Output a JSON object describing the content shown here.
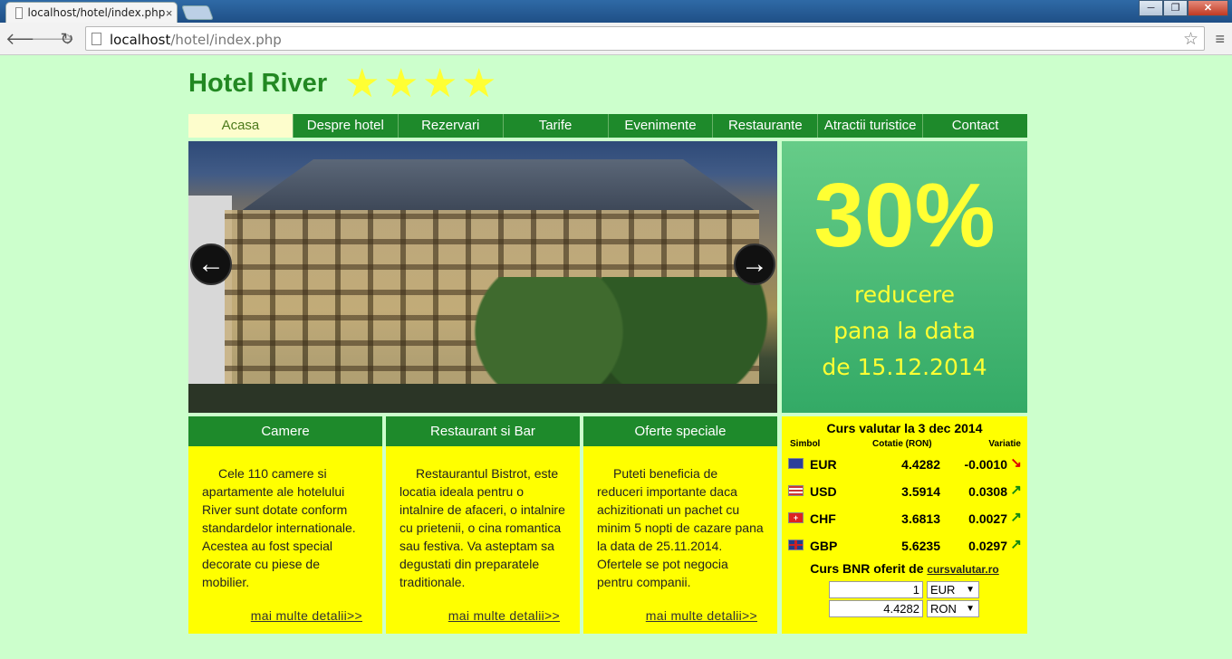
{
  "browser": {
    "tab_title": "localhost/hotel/index.php",
    "tab_close": "×",
    "url_host": "localhost",
    "url_path": "/hotel/index.php",
    "window_buttons": [
      "─",
      "❐",
      "✕"
    ]
  },
  "header": {
    "title": "Hotel River",
    "stars": [
      "★",
      "★",
      "★",
      "★"
    ]
  },
  "nav": [
    {
      "label": "Acasa",
      "active": true
    },
    {
      "label": "Despre hotel"
    },
    {
      "label": "Rezervari"
    },
    {
      "label": "Tarife"
    },
    {
      "label": "Evenimente"
    },
    {
      "label": "Restaurante"
    },
    {
      "label": "Atractii turistice"
    },
    {
      "label": "Contact"
    }
  ],
  "slider": {
    "prev_glyph": "←",
    "next_glyph": "→"
  },
  "promo": {
    "percent": "30%",
    "line1": "reducere",
    "line2": "pana la data",
    "line3": "de 15.12.2014"
  },
  "boxes": [
    {
      "title": "Camere",
      "text": "Cele 110 camere si apartamente ale hotelului River sunt dotate conform standardelor internationale. Acestea au fost special decorate cu piese de mobilier.",
      "link": "mai multe detalii>>"
    },
    {
      "title": "Restaurant si Bar",
      "text": "Restaurantul Bistrot, este locatia ideala pentru o intalnire de afaceri, o intalnire cu prietenii, o cina romantica sau festiva. Va asteptam sa degustati din preparatele traditionale.",
      "link": "mai multe detalii>>"
    },
    {
      "title": "Oferte speciale",
      "text": "Puteti beneficia de reduceri importante daca achizitionati un pachet cu minim 5 nopti de cazare pana la data de 25.11.2014. Ofertele se pot negocia pentru companii.",
      "link": "mai multe detalii>>"
    }
  ],
  "currency": {
    "title": "Curs valutar la 3 dec 2014",
    "col_symbol": "Simbol",
    "col_rate": "Cotatie (RON)",
    "col_change": "Variatie",
    "rows": [
      {
        "symbol": "EUR",
        "rate": "4.4282",
        "change": "-0.0010",
        "trend": "↘",
        "flag": "eu-flag-icon"
      },
      {
        "symbol": "USD",
        "rate": "3.5914",
        "change": "0.0308",
        "trend": "↗",
        "flag": "us-flag-icon"
      },
      {
        "symbol": "CHF",
        "rate": "3.6813",
        "change": "0.0027",
        "trend": "↗",
        "flag": "ch-flag-icon"
      },
      {
        "symbol": "GBP",
        "rate": "5.6235",
        "change": "0.0297",
        "trend": "↗",
        "flag": "gb-flag-icon"
      }
    ],
    "bnr_text": "Curs BNR oferit de",
    "bnr_link": "cursvalutar.ro",
    "converter": {
      "amount": "1",
      "amount_currency": "EUR",
      "result": "4.4282",
      "result_currency": "RON"
    }
  }
}
